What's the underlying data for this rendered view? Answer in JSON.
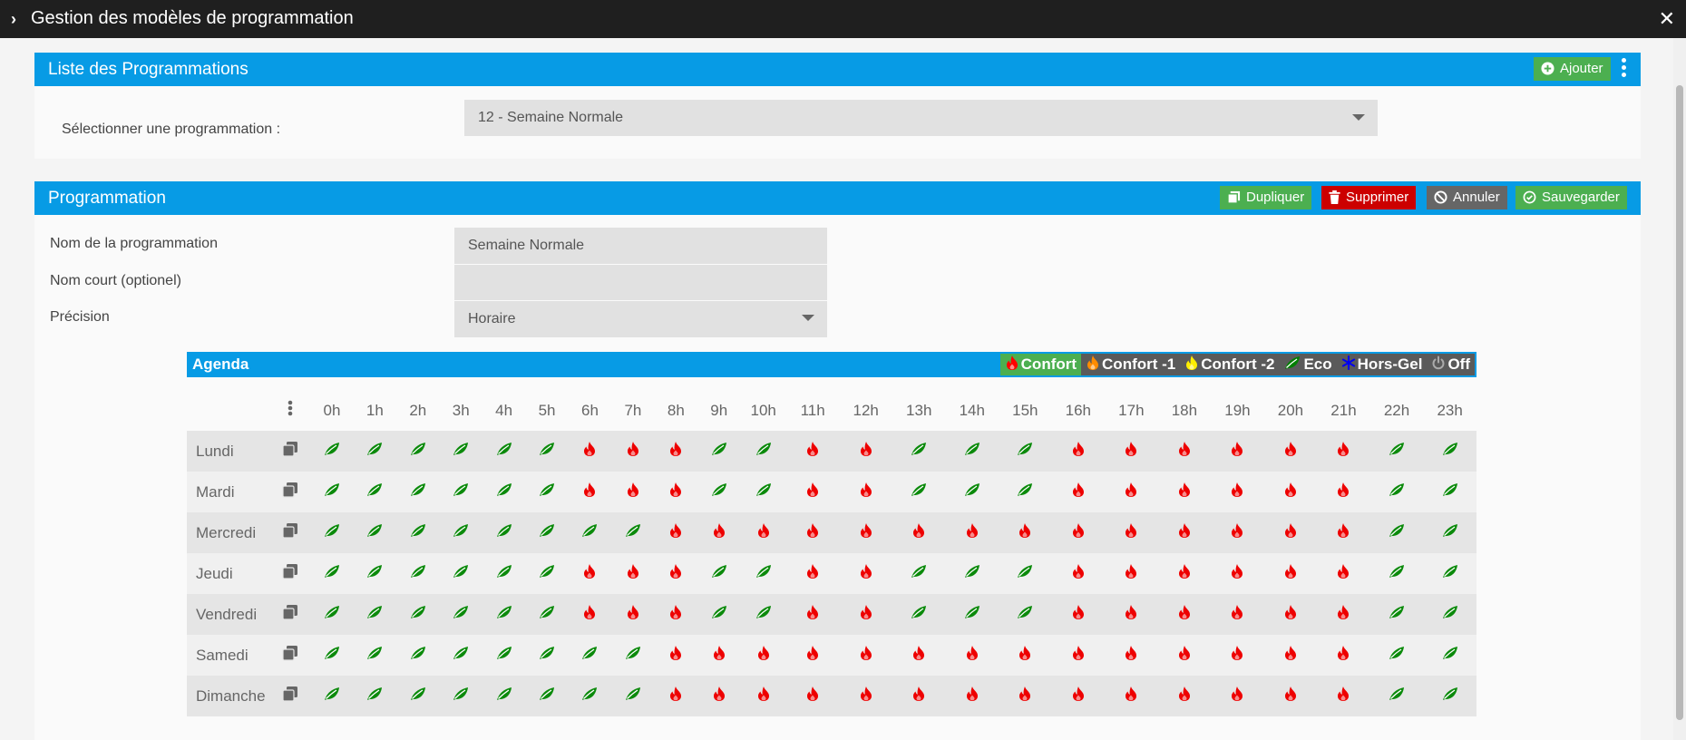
{
  "window": {
    "title": "Gestion des modèles de programmation"
  },
  "list_panel": {
    "title": "Liste des Programmations",
    "add_label": "Ajouter",
    "select_label": "Sélectionner une programmation :",
    "select_value": "12 - Semaine Normale"
  },
  "prog_panel": {
    "title": "Programmation",
    "duplicate_label": "Dupliquer",
    "delete_label": "Supprimer",
    "cancel_label": "Annuler",
    "save_label": "Sauvegarder",
    "name_label": "Nom de la programmation",
    "name_value": "Semaine Normale",
    "short_label": "Nom court (optionel)",
    "short_value": "",
    "precision_label": "Précision",
    "precision_value": "Horaire"
  },
  "agenda": {
    "title": "Agenda",
    "legend": [
      {
        "label": "Confort",
        "icon": "flame-icon",
        "color": "#ff0000"
      },
      {
        "label": "Confort -1",
        "icon": "flame-icon",
        "color": "#ff8c00"
      },
      {
        "label": "Confort -2",
        "icon": "flame-icon",
        "color": "#ffee00"
      },
      {
        "label": "Eco",
        "icon": "leaf-icon",
        "color": "#008000"
      },
      {
        "label": "Hors-Gel",
        "icon": "snowflake-icon",
        "color": "#0000ee"
      },
      {
        "label": "Off",
        "icon": "power-icon",
        "color": "#aaaaaa"
      }
    ],
    "hours": [
      "0h",
      "1h",
      "2h",
      "3h",
      "4h",
      "5h",
      "6h",
      "7h",
      "8h",
      "9h",
      "10h",
      "11h",
      "12h",
      "13h",
      "14h",
      "15h",
      "16h",
      "17h",
      "18h",
      "19h",
      "20h",
      "21h",
      "22h",
      "23h"
    ],
    "days": [
      {
        "name": "Lundi",
        "modes": "EEEEEECCCEECCEEECCCCCCE"
      },
      {
        "name": "Mardi",
        "modes": "EEEEEECCCEECCEEECCCCCCE"
      },
      {
        "name": "Mercredi",
        "modes": "EEEEEEEECCCCCCCCCCCCCCE"
      },
      {
        "name": "Jeudi",
        "modes": "EEEEEECCCEECCEEECCCCCCE"
      },
      {
        "name": "Vendredi",
        "modes": "EEEEEECCCEECCEEECCCCCCE"
      },
      {
        "name": "Samedi",
        "modes": "EEEEEEEECCCCCCCCCCCCCCE"
      },
      {
        "name": "Dimanche",
        "modes": "EEEEEEEECCCCCCCCCCCCCCE"
      }
    ],
    "mode_legend": {
      "C": "Confort",
      "E": "Eco"
    }
  }
}
